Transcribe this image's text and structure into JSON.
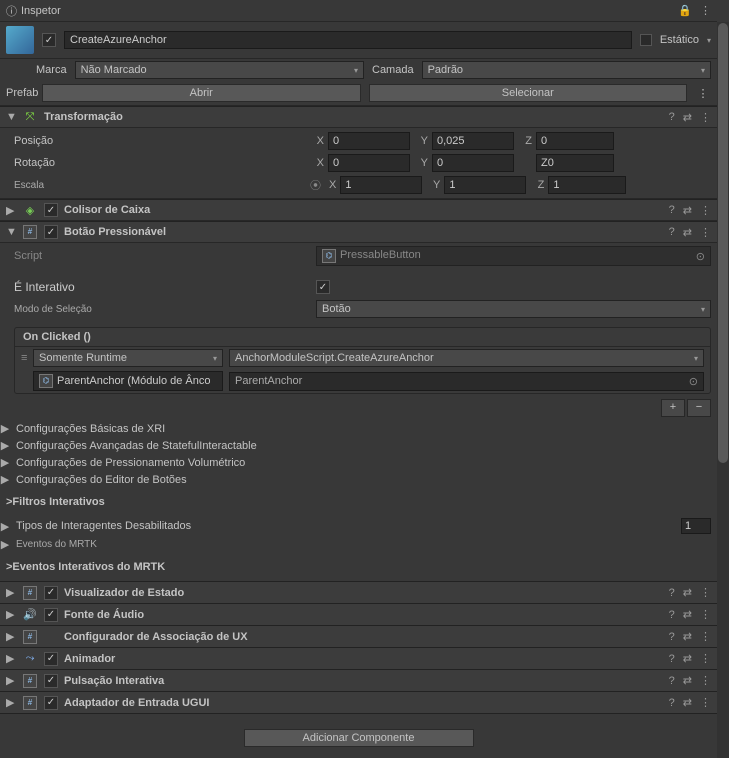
{
  "header": {
    "title": "Inspetor"
  },
  "object": {
    "name": "CreateAzureAnchor",
    "static_label": "Estático"
  },
  "tag": {
    "label": "Marca",
    "value": "Não Marcado"
  },
  "layer": {
    "label": "Camada",
    "value": "Padrão"
  },
  "prefab": {
    "label": "Prefab",
    "open": "Abrir",
    "select": "Selecionar"
  },
  "transform": {
    "title": "Transformação",
    "position": {
      "label": "Posição",
      "x": "0",
      "y": "0,025",
      "z": "0"
    },
    "rotation": {
      "label": "Rotação",
      "x": "0",
      "y": "0",
      "z": "Z0"
    },
    "scale": {
      "label": "Escala",
      "x": "1",
      "y": "1",
      "z": "1"
    },
    "axes": {
      "x": "X",
      "y": "Y",
      "z": "Z"
    }
  },
  "boxCollider": {
    "title": "Colisor de Caixa"
  },
  "pressable": {
    "title": "Botão Pressionável",
    "script_label": "Script",
    "script_value": "PressableButton",
    "interactive_label": "É Interativo",
    "select_mode_label": "Modo de Seleção",
    "select_mode_value": "Botão",
    "event": {
      "title": "On Clicked ()",
      "runtime": "Somente Runtime",
      "method": "AnchorModuleScript.CreateAzureAnchor",
      "target": "ParentAnchor (Módulo de Ânco",
      "argument": "ParentAnchor"
    },
    "sections": {
      "xri_basic": "Configurações Básicas de XRI",
      "stateful": "Configurações Avançadas de StatefulInteractable",
      "volumetric": "Configurações de Pressionamento Volumétrico",
      "editor": "Configurações do Editor de Botões",
      "filters": ">Filtros Interativos",
      "disabled": "Tipos de Interagentes Desabilitados",
      "disabled_value": "1",
      "mrtk_events": "Eventos do MRTK",
      "mrtk_interactive": ">Eventos Interativos do MRTK"
    }
  },
  "subs": {
    "state_viz": "Visualizador de Estado",
    "audio": "Fonte de Áudio",
    "ux_binding": "Configurador de Associação de UX",
    "animator": "Animador",
    "pulse": "Pulsação Interativa",
    "ugui": "Adaptador de Entrada UGUI"
  },
  "add_component": "Adicionar Componente"
}
